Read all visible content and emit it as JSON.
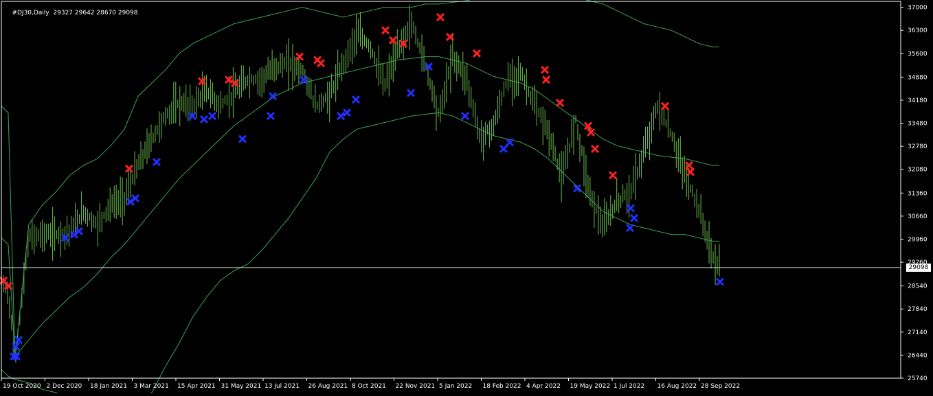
{
  "header": {
    "symbol": "#DJ30,Daily",
    "ohlc": "29327 29642 28670 29098"
  },
  "price_tag": "29098",
  "colors": {
    "background": "#000000",
    "frame": "#ffffff",
    "bars": "#6fbf4f",
    "bands": "#3fa35a",
    "sell_marker": "#ff2020",
    "buy_marker": "#2030ff",
    "price_line": "#c8d8d8"
  },
  "chart_data": {
    "type": "bar",
    "title": "#DJ30,Daily",
    "ohlc_last": {
      "open": 29327,
      "high": 29642,
      "low": 28670,
      "close": 29098
    },
    "ylim": [
      25740,
      37180
    ],
    "y_ticks": [
      37000,
      36300,
      35600,
      34880,
      34180,
      33480,
      32780,
      32080,
      31360,
      30660,
      29960,
      29260,
      28540,
      27840,
      27140,
      26440,
      25740
    ],
    "x_ticks": [
      "19 Oct 2020",
      "2 Dec 2020",
      "18 Jan 2021",
      "3 Mar 2021",
      "15 Apr 2021",
      "31 May 2021",
      "13 Jul 2021",
      "26 Aug 2021",
      "8 Oct 2021",
      "22 Nov 2021",
      "5 Jan 2022",
      "18 Feb 2022",
      "4 Apr 2022",
      "19 May 2022",
      "1 Jul 2022",
      "16 Aug 2022",
      "28 Sep 2022"
    ],
    "current_price": 29098,
    "x": [
      0,
      10,
      20,
      40,
      60,
      80,
      100,
      120,
      140,
      160,
      180,
      200,
      220,
      240,
      260,
      280,
      300,
      320,
      340,
      360,
      380,
      400,
      420,
      440,
      460,
      480,
      500,
      520,
      540,
      560,
      580,
      600,
      620,
      640,
      660,
      680,
      700,
      720,
      740,
      760,
      780,
      800,
      820,
      840,
      860,
      880,
      900,
      920,
      940,
      960,
      980,
      1000,
      1020,
      1040,
      1050
    ],
    "series": [
      {
        "values": [
          28700,
          28400,
          26300,
          30000,
          30100,
          30100,
          30200,
          30800,
          30400,
          31000,
          31200,
          32200,
          33000,
          33700,
          34100,
          34000,
          34500,
          34000,
          34400,
          34800,
          34800,
          35200,
          35300,
          35100,
          34000,
          34300,
          35300,
          36200,
          35800,
          34600,
          35700,
          36500,
          35300,
          33700,
          35500,
          34900,
          33000,
          33400,
          34800,
          35000,
          34000,
          33200,
          31800,
          33600,
          31400,
          30300,
          31100,
          31400,
          32600,
          34000,
          33100,
          31900,
          30900,
          29400,
          29098
        ]
      },
      {
        "values": [
          30000,
          29800,
          26400,
          26900,
          27400,
          27800,
          28200,
          28500,
          28900,
          29400,
          29800,
          30300,
          30800,
          31300,
          31800,
          32200,
          32600,
          33000,
          33400,
          33700,
          34000,
          34300,
          34500,
          34700,
          34800,
          34900,
          35000,
          35100,
          35200,
          35300,
          35400,
          35450,
          35500,
          35500,
          35400,
          35300,
          35100,
          34900,
          34800,
          34700,
          34500,
          34200,
          33900,
          33600,
          33300,
          33000,
          32800,
          32700,
          32600,
          32500,
          32450,
          32400,
          32300,
          32200,
          32200
        ]
      },
      {
        "values": [
          34000,
          33800,
          26300,
          30400,
          31000,
          31400,
          31900,
          32200,
          32400,
          32800,
          33300,
          34300,
          34700,
          35100,
          35600,
          35900,
          36100,
          36300,
          36500,
          36600,
          36700,
          36800,
          36900,
          37000,
          36900,
          36800,
          36700,
          36800,
          36900,
          37000,
          37000,
          37000,
          37100,
          37100,
          37150,
          37200,
          37300,
          37300,
          37400,
          37400,
          37400,
          37400,
          37400,
          37300,
          37200,
          37100,
          36900,
          36700,
          36500,
          36400,
          36300,
          36100,
          35900,
          35800,
          35800
        ]
      },
      {
        "values": [
          26000,
          25800,
          25700,
          25600,
          25400,
          25300,
          25100,
          25000,
          24900,
          24900,
          24900,
          25100,
          25300,
          26100,
          26800,
          27600,
          28200,
          28700,
          29000,
          29200,
          29600,
          30100,
          30600,
          31200,
          31800,
          32600,
          33000,
          33300,
          33400,
          33500,
          33600,
          33700,
          33750,
          33800,
          33700,
          33500,
          33300,
          33100,
          33000,
          32900,
          32700,
          32400,
          32000,
          31600,
          31200,
          30800,
          30600,
          30400,
          30300,
          30200,
          30100,
          30100,
          30000,
          29900,
          29900
        ]
      }
    ],
    "sell_marker_prices": [
      28700,
      28540,
      32100,
      34750,
      34800,
      34700,
      35500,
      35400,
      35300,
      36300,
      36000,
      35900,
      36700,
      36100,
      35600,
      35100,
      34800,
      34100,
      33400,
      33200,
      32700,
      31900,
      34000,
      32200,
      32000
    ],
    "buy_marker_prices": [
      26400,
      26900,
      26400,
      26700,
      30000,
      30100,
      30200,
      31100,
      31200,
      32300,
      33700,
      33600,
      33700,
      33000,
      33700,
      34300,
      34800,
      34200,
      33700,
      33800,
      35200,
      34400,
      33700,
      32900,
      32700,
      31500,
      30900,
      30300,
      30600,
      28670
    ]
  }
}
